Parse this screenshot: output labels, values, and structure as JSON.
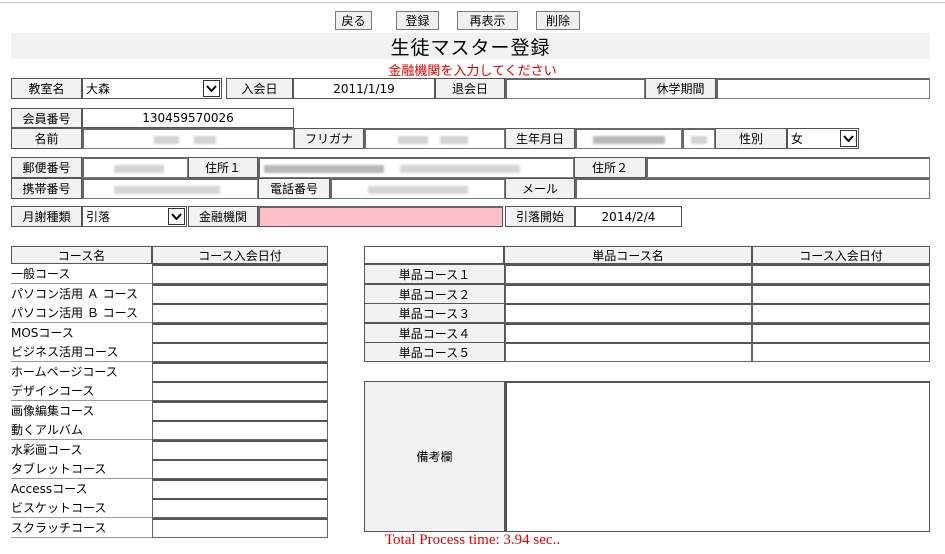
{
  "toolbar": {
    "back": "戻る",
    "register": "登録",
    "redisplay": "再表示",
    "delete": "削除"
  },
  "title": "生徒マスター登録",
  "alert": "金融機関を入力してください",
  "form": {
    "classroom_label": "教室名",
    "classroom_value": "大森",
    "join_date_label": "入会日",
    "join_date_value": "2011/1/19",
    "leave_date_label": "退会日",
    "leave_date_value": "",
    "leave_period_label": "休学期間",
    "leave_period_value": "",
    "member_no_label": "会員番号",
    "member_no_value": "130459570026",
    "name_label": "名前",
    "furigana_label": "フリガナ",
    "birthday_label": "生年月日",
    "gender_label": "性別",
    "gender_value": "女",
    "postal_label": "郵便番号",
    "address1_label": "住所１",
    "address2_label": "住所２",
    "mobile_label": "携帯番号",
    "phone_label": "電話番号",
    "mail_label": "メール",
    "fee_type_label": "月謝種類",
    "fee_type_value": "引落",
    "bank_label": "金融機関",
    "bank_value": "",
    "debit_start_label": "引落開始",
    "debit_start_value": "2014/2/4"
  },
  "courses": {
    "header_name": "コース名",
    "header_date": "コース入会日付",
    "items": [
      "一般コース",
      "パソコン活用 Ａ コース",
      "パソコン活用 Ｂ コース",
      "MOSコース",
      "ビジネス活用コース",
      "ホームページコース",
      "デザインコース",
      "画像編集コース",
      "動くアルバム",
      "水彩画コース",
      "タブレットコース",
      "Accessコース",
      "ビスケットコース",
      "スクラッチコース"
    ]
  },
  "single_courses": {
    "header_name": "単品コース名",
    "header_date": "コース入会日付",
    "labels": [
      "単品コース１",
      "単品コース２",
      "単品コース３",
      "単品コース４",
      "単品コース５"
    ]
  },
  "remarks_label": "備考欄",
  "footer": "Total Process time: 3.94 sec.."
}
